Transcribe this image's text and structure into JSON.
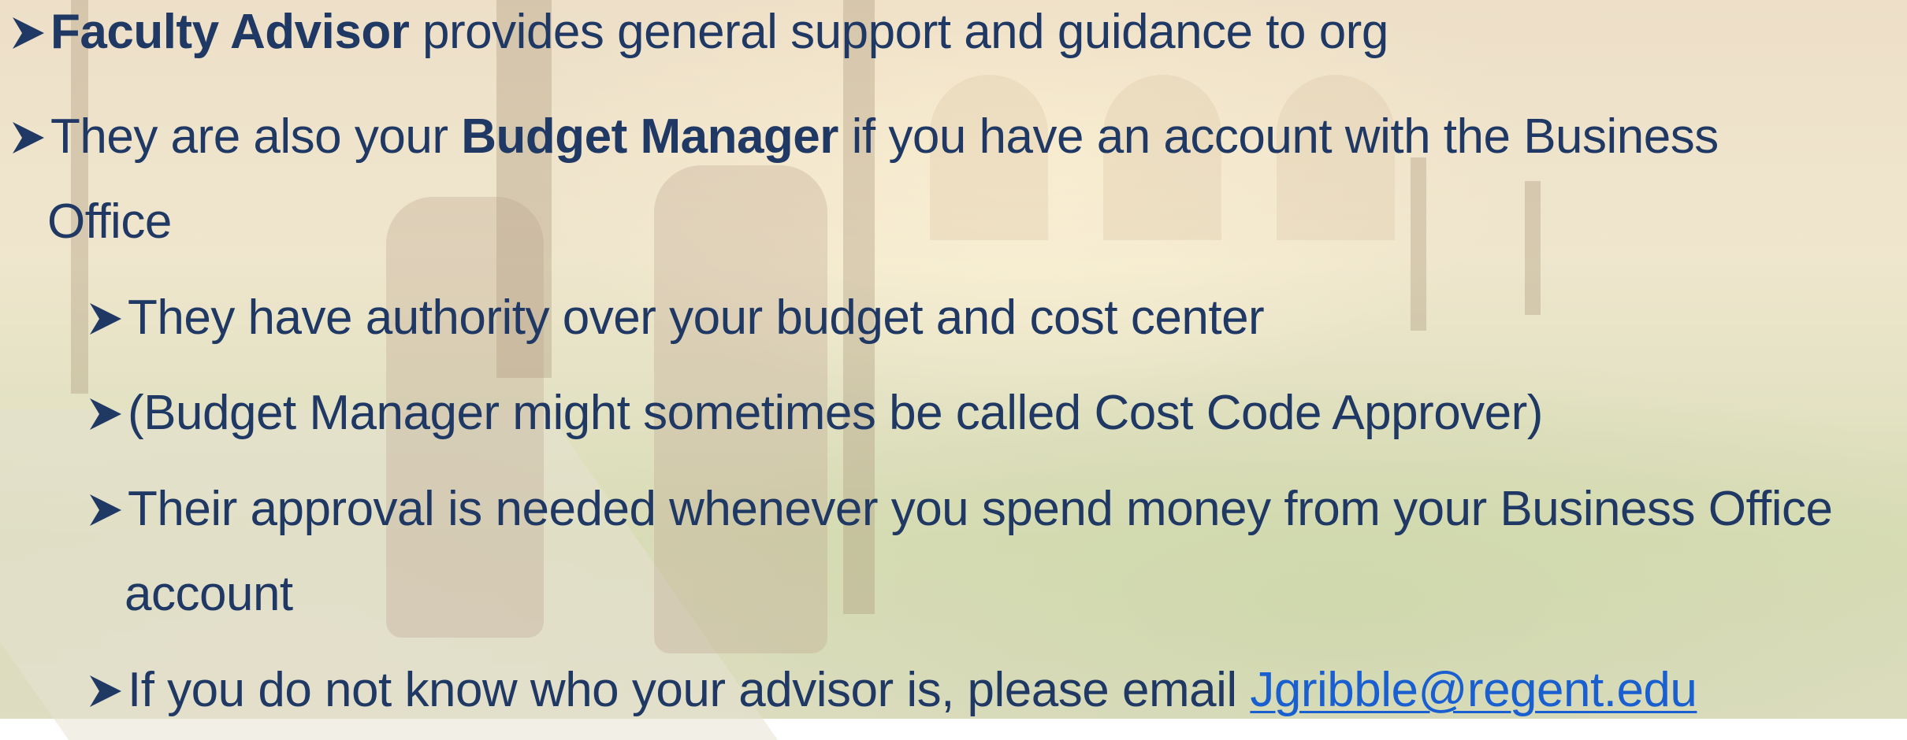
{
  "bullets": {
    "b1": {
      "bold": "Faculty Advisor",
      "rest": " provides general support and guidance to org"
    },
    "b2": {
      "pre": "They are also your ",
      "bold": "Budget Manager",
      "rest": " if you have an account with the Business",
      "cont": "Office"
    },
    "sub1": "They have authority over your budget and cost center",
    "sub2": "(Budget Manager might sometimes be called Cost Code Approver)",
    "sub3": {
      "text": "Their approval is needed whenever you spend money from your Business Office",
      "cont": "account"
    },
    "sub4": {
      "text": "If you do not know who your advisor is, please email ",
      "link": "Jgribble@regent.edu"
    }
  },
  "colors": {
    "text": "#1f3864",
    "link": "#1a5fd0"
  },
  "icons": {
    "bullet": "arrowhead-bullet-icon"
  }
}
